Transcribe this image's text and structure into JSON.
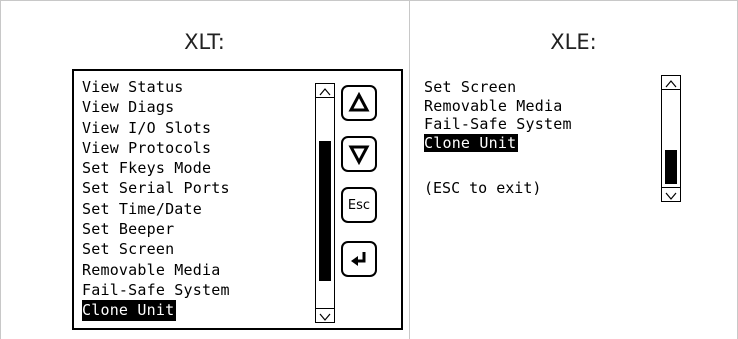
{
  "panels": {
    "xlt": {
      "header": "XLT:",
      "menu_items": [
        "View Status",
        "View Diags",
        "View I/O Slots",
        "View Protocols",
        "Set Fkeys Mode",
        "Set Serial Ports",
        "Set Time/Date",
        "Set Beeper",
        "Set Screen",
        "Removable Media",
        "Fail-Safe System",
        "Clone Unit"
      ],
      "selected_item": "Clone Unit",
      "scroll_position": 0.6,
      "buttons": {
        "up": "up-arrow-icon",
        "down": "down-arrow-icon",
        "esc_label": "Esc",
        "enter": "enter-arrow-icon"
      }
    },
    "xle": {
      "header": "XLE:",
      "menu_items": [
        "Set Screen",
        "Removable Media",
        "Fail-Safe System",
        "Clone Unit"
      ],
      "selected_item": "Clone Unit",
      "hint": "(ESC to exit)",
      "scroll_position": 0.85
    }
  },
  "colors": {
    "grid": "#c8c8c8",
    "screen_border": "#000000",
    "selection_bg": "#000000",
    "selection_fg": "#ffffff"
  }
}
